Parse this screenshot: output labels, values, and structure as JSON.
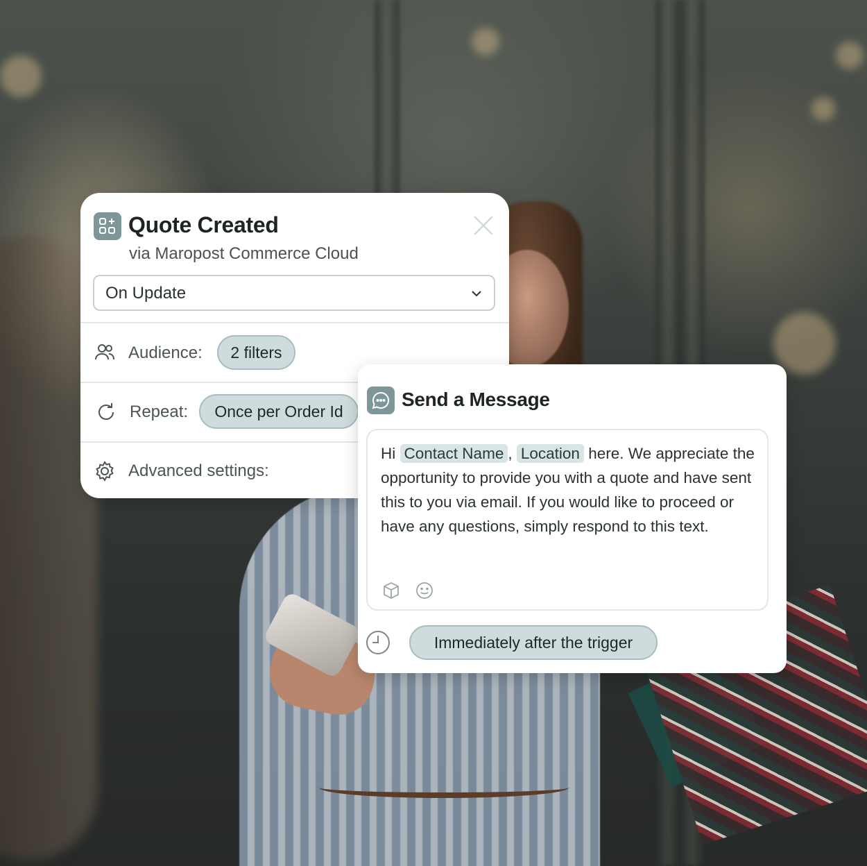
{
  "trigger_card": {
    "title": "Quote Created",
    "subtitle": "via Maropost Commerce Cloud",
    "close_icon": "close-icon",
    "select": {
      "value": "On Update"
    },
    "audience": {
      "label": "Audience:",
      "chip": "2 filters"
    },
    "repeat": {
      "label": "Repeat:",
      "chip": "Once per Order Id"
    },
    "advanced": {
      "label": "Advanced settings:"
    }
  },
  "message_card": {
    "title": "Send a Message",
    "body": {
      "greeting": "Hi",
      "tag_contact": "Contact Name",
      "separator": ",",
      "tag_location": "Location",
      "rest": "here. We appreciate the opportunity to provide you with a quote and have sent this to you via email. If you would like to proceed or have any questions, simply respond to this text."
    },
    "tools": [
      "cube-icon",
      "smiley-icon"
    ],
    "timing": "Immediately after the trigger"
  },
  "colors": {
    "accent_icon_bg": "#7f9698",
    "chip_bg": "#cfdcde",
    "chip_border": "#a9bcbe",
    "tag_bg": "#d9e4e5"
  }
}
